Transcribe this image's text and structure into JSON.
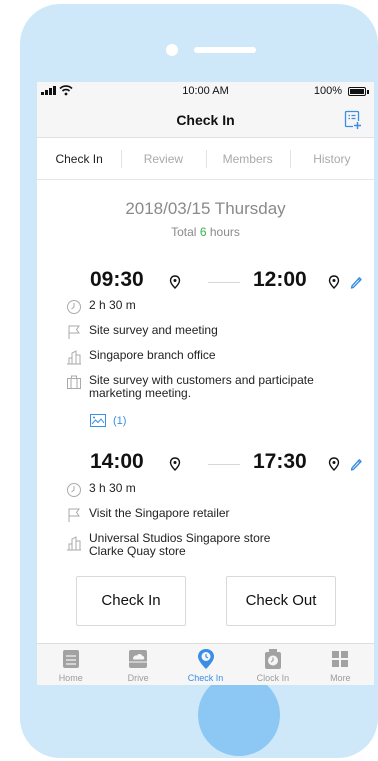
{
  "status_bar": {
    "time": "10:00 AM",
    "battery": "100%"
  },
  "header": {
    "title": "Check In"
  },
  "tabs": [
    {
      "label": "Check In",
      "active": true
    },
    {
      "label": "Review",
      "active": false
    },
    {
      "label": "Members",
      "active": false
    },
    {
      "label": "History",
      "active": false
    }
  ],
  "summary": {
    "date": "2018/03/15  Thursday",
    "total_prefix": "Total",
    "total_hours": "6",
    "total_suffix": "hours"
  },
  "entries": [
    {
      "start": "09:30",
      "end": "12:00",
      "duration": "2 h 30 m",
      "purpose": "Site survey and meeting",
      "location": "Singapore branch office",
      "notes": "Site survey with customers and participate marketing meeting.",
      "attachment": "(1)"
    },
    {
      "start": "14:00",
      "end": "17:30",
      "duration": "3 h 30 m",
      "purpose": "Visit the Singapore retailer",
      "location_line1": "Universal Studios Singapore store",
      "location_line2": "Clarke Quay store"
    }
  ],
  "actions": {
    "check_in": "Check In",
    "check_out": "Check Out"
  },
  "bottom_nav": [
    {
      "label": "Home",
      "icon": "home-icon"
    },
    {
      "label": "Drive",
      "icon": "cloud-drive-icon"
    },
    {
      "label": "Check In",
      "icon": "location-pin-icon",
      "active": true
    },
    {
      "label": "Clock In",
      "icon": "clock-icon"
    },
    {
      "label": "More",
      "icon": "grid-icon"
    }
  ],
  "colors": {
    "accent": "#3a8ee6",
    "hours": "#39b44a",
    "phone_body": "#cfe8f9",
    "home_button": "#8cc8f3"
  }
}
